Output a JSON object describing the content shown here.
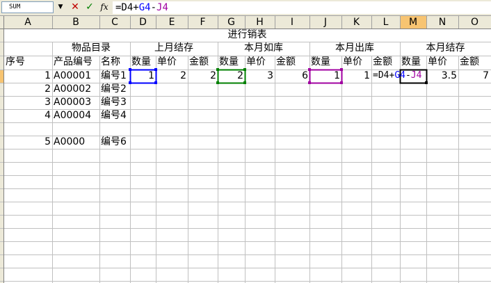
{
  "namebox": {
    "value": "SUM",
    "dropdown": "▼"
  },
  "formula_bar": {
    "cancel_icon": "✕",
    "enter_icon": "✓",
    "fx_icon": "fx",
    "formula_parts": {
      "p1": "=D4+",
      "p2": "G4",
      "p3": "-",
      "p4": "J4"
    }
  },
  "columns": [
    "A",
    "B",
    "C",
    "D",
    "E",
    "F",
    "G",
    "H",
    "I",
    "J",
    "K",
    "L",
    "M",
    "N",
    "O"
  ],
  "active_column": "M",
  "rows": {
    "r1": {
      "title": "进行销表"
    },
    "r2": {
      "goods_catalog": "物品目录",
      "last_month": "上月结存",
      "in_month": "本月如库",
      "out_month": "本月出库",
      "this_month": "本月结存"
    },
    "r3": {
      "a": "序号",
      "b": "产品编号",
      "c": "名称",
      "d": "数量",
      "e": "单价",
      "f": "金额",
      "g": "数量",
      "h": "单价",
      "i": "金额",
      "j": "数量",
      "k": "单价",
      "l": "金额",
      "m": "数量",
      "n": "单价",
      "o": "金额"
    },
    "r4": {
      "a": "1",
      "b": "A00001",
      "c": "编号1",
      "d": "1",
      "e": "2",
      "f": "2",
      "g": "2",
      "h": "3",
      "i": "6",
      "j": "1",
      "k": "1",
      "m_formula": {
        "p1": "=D4+",
        "p2": "G4",
        "p3": "-",
        "p4": "J4"
      },
      "n": "3.5",
      "o": "7"
    },
    "r5": {
      "a": "2",
      "b": "A00002",
      "c": "编号2"
    },
    "r6": {
      "a": "3",
      "b": "A00003",
      "c": "编号3"
    },
    "r7": {
      "a": "4",
      "b": "A00004",
      "c": "编号4"
    },
    "r9": {
      "a": "5",
      "b": "A0000",
      "c": "编号6"
    }
  },
  "colors": {
    "ref_d": "#0000ff",
    "ref_g": "#008000",
    "ref_j": "#a000a0",
    "header_active": "#f7c471"
  }
}
